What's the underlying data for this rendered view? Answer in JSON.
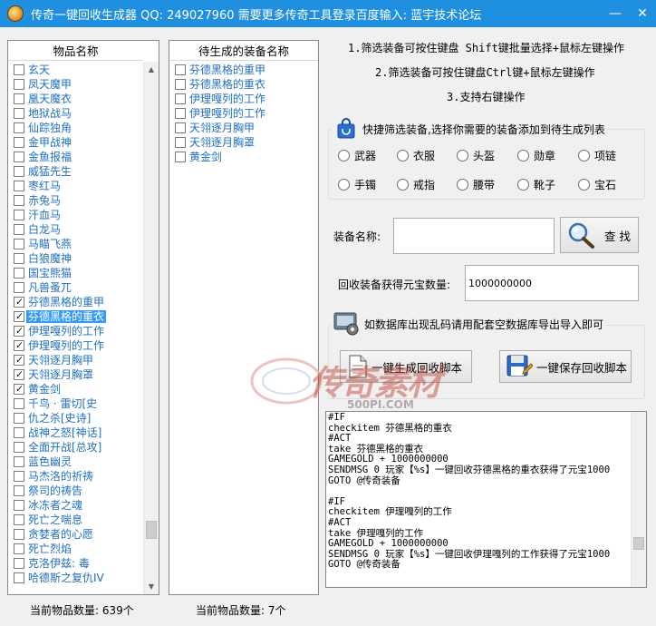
{
  "window": {
    "title": "传奇一键回收生成器   QQ: 249027960   需要更多传奇工具登录百度输入: 蓝宇技术论坛",
    "minimize_glyph": "—",
    "close_glyph": "✕",
    "icon": "app-icon"
  },
  "items_panel": {
    "header": "物品名称",
    "items": [
      {
        "label": "玄天",
        "checked": false
      },
      {
        "label": "凤天魔甲",
        "checked": false
      },
      {
        "label": "凰天魔衣",
        "checked": false
      },
      {
        "label": "地狱战马",
        "checked": false
      },
      {
        "label": "仙踪独角",
        "checked": false
      },
      {
        "label": "金甲战神",
        "checked": false
      },
      {
        "label": "金鱼报福",
        "checked": false
      },
      {
        "label": "威猛先生",
        "checked": false
      },
      {
        "label": "枣红马",
        "checked": false
      },
      {
        "label": "赤兔马",
        "checked": false
      },
      {
        "label": "汗血马",
        "checked": false
      },
      {
        "label": "白龙马",
        "checked": false
      },
      {
        "label": "马瞄飞燕",
        "checked": false
      },
      {
        "label": "白狼魔神",
        "checked": false
      },
      {
        "label": "国宝熊猫",
        "checked": false
      },
      {
        "label": "凡兽蚤兀",
        "checked": false
      },
      {
        "label": "芬德黑格的重甲",
        "checked": true
      },
      {
        "label": "芬德黑格的重衣",
        "checked": true,
        "selected": true
      },
      {
        "label": "伊理嘎列的工作",
        "checked": true
      },
      {
        "label": "伊理嘎列的工作",
        "checked": true
      },
      {
        "label": "天翎逐月胸甲",
        "checked": true
      },
      {
        "label": "天翎逐月胸罩",
        "checked": true
      },
      {
        "label": "黄金剑",
        "checked": true
      },
      {
        "label": "千鸟 · 雷切[史",
        "checked": false
      },
      {
        "label": "仇之杀[史诗]",
        "checked": false
      },
      {
        "label": "战神之怒[神话]",
        "checked": false
      },
      {
        "label": "全面开战[总攻]",
        "checked": false
      },
      {
        "label": "蓝色幽灵",
        "checked": false
      },
      {
        "label": "马杰洛的祈祷",
        "checked": false
      },
      {
        "label": "祭司的祷告",
        "checked": false
      },
      {
        "label": "冰冻者之魂",
        "checked": false
      },
      {
        "label": "死亡之喘息",
        "checked": false
      },
      {
        "label": "贪婪者的心愿",
        "checked": false
      },
      {
        "label": "死亡烈焰",
        "checked": false
      },
      {
        "label": "克洛伊兹: 毒",
        "checked": false
      },
      {
        "label": "哈德斯之复仇IV",
        "checked": false
      }
    ],
    "count_label": "当前物品数量: 639个",
    "scroll_up": "▲",
    "scroll_down": "▼"
  },
  "pending_panel": {
    "header": "待生成的装备名称",
    "items": [
      {
        "label": "芬德黑格的重甲"
      },
      {
        "label": "芬德黑格的重衣"
      },
      {
        "label": "伊理嘎列的工作"
      },
      {
        "label": "伊理嘎列的工作"
      },
      {
        "label": "天翎逐月胸甲"
      },
      {
        "label": "天翎逐月胸罩"
      },
      {
        "label": "黄金剑"
      }
    ],
    "count_label": "当前物品数量: 7个"
  },
  "hints": [
    "1.筛选装备可按住键盘 Shift键批量选择+鼠标左键操作",
    "2.筛选装备可按住键盘Ctrl键+鼠标左键操作",
    "3.支持右键操作"
  ],
  "filter_group": {
    "title": "快捷筛选装备,选择你需要的装备添加到待生成列表",
    "icon": "bag-icon",
    "options": [
      "武器",
      "衣服",
      "头盔",
      "勋章",
      "项链",
      "手镯",
      "戒指",
      "腰带",
      "靴子",
      "宝石"
    ]
  },
  "search": {
    "label": "装备名称:",
    "value": "",
    "button_label": "查 找",
    "button_icon": "magnifier-icon"
  },
  "gold": {
    "label": "回收装备获得元宝数量:",
    "value": "1000000000"
  },
  "script_group": {
    "title": "如数据库出现乱码请用配套空数据库导出导入即可",
    "icon": "gear-icon",
    "generate_label": "一键生成回收脚本",
    "save_label": "一键保存回收脚本",
    "generate_icon": "document-icon",
    "save_icon": "floppy-icon"
  },
  "watermark": {
    "text": "传奇素材",
    "url": "500PI.COM"
  },
  "script_text": [
    "#IF",
    "checkitem 芬德黑格的重衣",
    "#ACT",
    "take 芬德黑格的重衣",
    "GAMEGOLD + 1000000000",
    "SENDMSG 0 玩家【%s】一键回收芬德黑格的重衣获得了元宝1000",
    "GOTO  @传奇装备",
    "",
    "#IF",
    "checkitem 伊理嘎列的工作",
    "#ACT",
    "take 伊理嘎列的工作",
    "GAMEGOLD + 1000000000",
    "SENDMSG 0 玩家【%s】一键回收伊理嘎列的工作获得了元宝1000",
    "GOTO  @传奇装备"
  ],
  "colors": {
    "titlebar": "#1f8fe0",
    "item_text": "#1f6fbf",
    "selection": "#3399ff"
  }
}
